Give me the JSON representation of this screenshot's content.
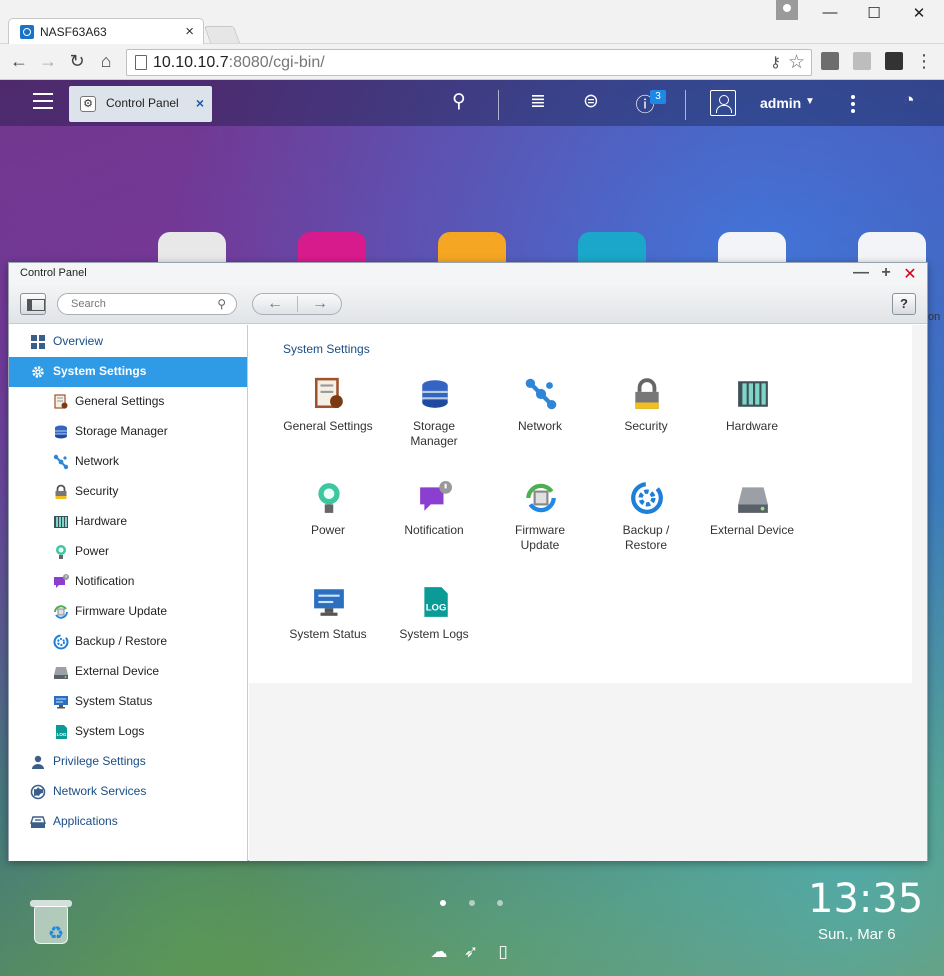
{
  "browser": {
    "tab_title": "NASF63A63",
    "tab_close": "×",
    "url_host": "10.10.10.7",
    "url_rest": ":8080/cgi-bin/",
    "window_controls": [
      "—",
      "☐",
      "✕"
    ]
  },
  "topbar": {
    "task_tab_label": "Control Panel",
    "task_tab_close": "×",
    "notification_count": "3",
    "user_name": "admin"
  },
  "window": {
    "title": "Control Panel",
    "search_placeholder": "Search",
    "help_label": "?"
  },
  "sidebar": {
    "items": [
      {
        "label": "Overview",
        "level": "top",
        "icon": "overview-icon",
        "color": "#3a5f8a"
      },
      {
        "label": "System Settings",
        "level": "top",
        "active": true,
        "icon": "gear-icon",
        "color": "#ffffff"
      },
      {
        "label": "General Settings",
        "level": "sub",
        "icon": "general-settings-icon",
        "color": "#a0522d"
      },
      {
        "label": "Storage Manager",
        "level": "sub",
        "icon": "storage-icon",
        "color": "#3465c4"
      },
      {
        "label": "Network",
        "level": "sub",
        "icon": "network-icon",
        "color": "#2f86d6"
      },
      {
        "label": "Security",
        "level": "sub",
        "icon": "lock-icon",
        "color": "#555555"
      },
      {
        "label": "Hardware",
        "level": "sub",
        "icon": "hardware-icon",
        "color": "#3f4f5a"
      },
      {
        "label": "Power",
        "level": "sub",
        "icon": "bulb-icon",
        "color": "#3cc7a0"
      },
      {
        "label": "Notification",
        "level": "sub",
        "icon": "notification-icon",
        "color": "#8a3fd1"
      },
      {
        "label": "Firmware Update",
        "level": "sub",
        "icon": "firmware-icon",
        "color": "#4caf50"
      },
      {
        "label": "Backup / Restore",
        "level": "sub",
        "icon": "backup-icon",
        "color": "#1e7fd8"
      },
      {
        "label": "External Device",
        "level": "sub",
        "icon": "external-device-icon",
        "color": "#5a6068"
      },
      {
        "label": "System Status",
        "level": "sub",
        "icon": "monitor-icon",
        "color": "#2a6fc0"
      },
      {
        "label": "System Logs",
        "level": "sub",
        "icon": "log-icon",
        "color": "#0a9b97"
      },
      {
        "label": "Privilege Settings",
        "level": "top",
        "icon": "user-icon",
        "color": "#3a5f8a"
      },
      {
        "label": "Network Services",
        "level": "top",
        "icon": "globe-icon",
        "color": "#3a5f8a"
      },
      {
        "label": "Applications",
        "level": "top",
        "icon": "applications-icon",
        "color": "#3a5f8a"
      }
    ]
  },
  "main": {
    "section_title": "System Settings",
    "tiles": [
      {
        "label": "General Settings",
        "icon": "general-settings-icon",
        "color": "#a0522d"
      },
      {
        "label": "Storage\nManager",
        "icon": "storage-icon",
        "color": "#3465c4"
      },
      {
        "label": "Network",
        "icon": "network-icon",
        "color": "#2f86d6"
      },
      {
        "label": "Security",
        "icon": "lock-icon",
        "color": "#666666"
      },
      {
        "label": "Hardware",
        "icon": "hardware-icon",
        "color": "#3f4f5a"
      },
      {
        "label": "Power",
        "icon": "bulb-icon",
        "color": "#3cc7a0"
      },
      {
        "label": "Notification",
        "icon": "notification-icon",
        "color": "#8a3fd1"
      },
      {
        "label": "Firmware\nUpdate",
        "icon": "firmware-icon",
        "color": "#4caf50"
      },
      {
        "label": "Backup /\nRestore",
        "icon": "backup-icon",
        "color": "#1e7fd8"
      },
      {
        "label": "External Device",
        "icon": "external-device-icon",
        "color": "#5a6068"
      },
      {
        "label": "System Status",
        "icon": "monitor-icon",
        "color": "#2a6fc0"
      },
      {
        "label": "System Logs",
        "icon": "log-icon",
        "color": "#0a9b97"
      }
    ]
  },
  "desktop": {
    "apps": [
      {
        "icon": "control-panel-app-icon",
        "color": "#e8e8e8"
      },
      {
        "icon": "hd-station-app-icon",
        "color": "#d81b8c"
      },
      {
        "icon": "file-station-app-icon",
        "color": "#f5a623"
      },
      {
        "icon": "backup-station-app-icon",
        "color": "#1aa7c9"
      },
      {
        "icon": "cloud-app-icon",
        "color": "#f2f4f8"
      },
      {
        "icon": "sync-app-icon",
        "color": "#f2f4f8"
      }
    ],
    "edge_text": "on",
    "clock": "13:35",
    "date": "Sun., Mar 6",
    "page_dots": 3,
    "active_page": 1
  },
  "colors": {
    "accent": "#2f9ae6",
    "link": "#1a4d86",
    "close": "#d0021b"
  }
}
